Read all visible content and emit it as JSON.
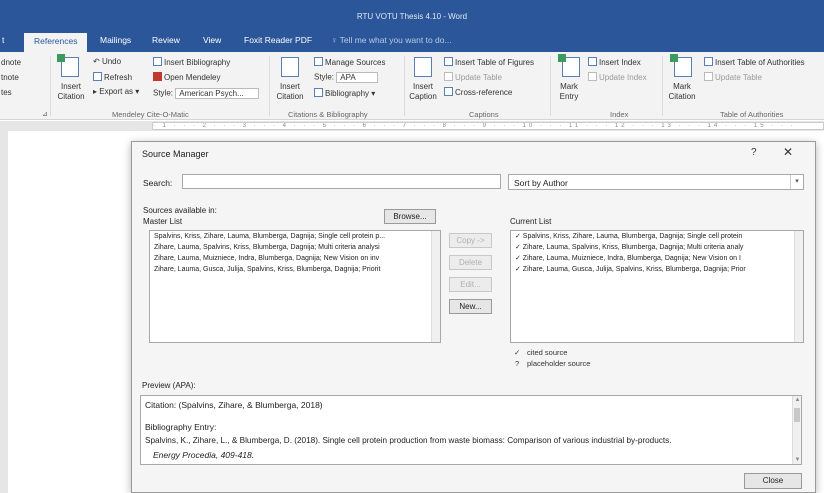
{
  "window": {
    "title": "RTU VOTU Thesis 4.10 - Word"
  },
  "tabs": [
    {
      "label": "t"
    },
    {
      "label": "References"
    },
    {
      "label": "Mailings"
    },
    {
      "label": "Review"
    },
    {
      "label": "View"
    },
    {
      "label": "Foxit Reader PDF"
    },
    {
      "label": "Tell me what you want to do..."
    }
  ],
  "ribbon": {
    "left_cut": [
      "dnote",
      "tnote",
      "tes"
    ],
    "mendeley": {
      "insert_citation": "Insert Citation",
      "undo": "Undo",
      "refresh": "Refresh",
      "export_as": "Export as",
      "insert_bibliography": "Insert Bibliography",
      "open_mendeley": "Open Mendeley",
      "style_label": "Style:",
      "style_value": "American Psych...",
      "group": "Mendeley Cite-O-Matic"
    },
    "citations": {
      "insert_citation": "Insert Citation",
      "manage_sources": "Manage Sources",
      "style_label": "Style:",
      "style_value": "APA",
      "bibliography": "Bibliography",
      "group": "Citations & Bibliography"
    },
    "captions": {
      "insert_caption": "Insert Caption",
      "insert_table_of_figures": "Insert Table of Figures",
      "update_table": "Update Table",
      "cross_reference": "Cross-reference",
      "group": "Captions"
    },
    "index": {
      "mark_entry": "Mark Entry",
      "insert_index": "Insert Index",
      "update_index": "Update Index",
      "group": "Index"
    },
    "authorities": {
      "mark_citation": "Mark Citation",
      "insert_table": "Insert Table of Authorities",
      "update_table": "Update Table",
      "group": "Table of Authorities"
    }
  },
  "ruler": {
    "text": "· 1 · · · 2 · · · 3 · · · 4 · · · 5 · · · 6 · · · 7 · · · 8 · · · 9 · · · 10 · · · 11 · · · 12 · · · 13 · · · 14 · · · 15 · · ·"
  },
  "dialog": {
    "title": "Source Manager",
    "help": "?",
    "close": "✕",
    "search_label": "Search:",
    "search_value": "",
    "sort_value": "Sort by Author",
    "sources_available_label": "Sources available in:",
    "master_list_label": "Master List",
    "browse_label": "Browse...",
    "current_list_label": "Current List",
    "master_list": [
      "Spalvins, Kriss, Zihare, Lauma, Blumberga, Dagnija; Single cell protein p...",
      "Zihare, Lauma, Spalvins, Kriss, Blumberga, Dagnija; Multi criteria analysi",
      "Zihare, Lauma, Muizniece, Indra, Blumberga, Dagnija; New Vision on inv",
      "Zihare, Lauma, Gusca, Julija, Spalvins, Kriss, Blumberga, Dagnija; Priorit"
    ],
    "current_list": [
      "✓ Spalvins, Kriss, Zihare, Lauma, Blumberga, Dagnija; Single cell protein",
      "✓ Zihare, Lauma, Spalvins, Kriss, Blumberga, Dagnija; Multi criteria analy",
      "✓ Zihare, Lauma, Muizniece, Indra, Blumberga, Dagnija; New Vision on I",
      "✓ Zihare, Lauma, Gusca, Julija, Spalvins, Kriss, Blumberga, Dagnija; Prior"
    ],
    "copy_label": "Copy ->",
    "delete_label": "Delete",
    "edit_label": "Edit...",
    "new_label": "New...",
    "legend_cited_symbol": "✓",
    "legend_cited": "cited source",
    "legend_placeholder_symbol": "?",
    "legend_placeholder": "placeholder source",
    "preview_label": "Preview (APA):",
    "preview": {
      "citation": "Citation:  (Spalvins, Zihare, & Blumberga, 2018)",
      "bib_label": "Bibliography Entry:",
      "bib_line1": "Spalvins, K., Zihare, L., & Blumberga, D. (2018). Single cell protein production from waste biomass: Comparison of various industrial by-products.",
      "bib_line2": "Energy Procedia, 409-418."
    },
    "close_label": "Close"
  },
  "colors": {
    "accent": "#2b579a",
    "ribbon_bg": "#f3f3f3",
    "dialog_bg": "#f5f5f5"
  }
}
